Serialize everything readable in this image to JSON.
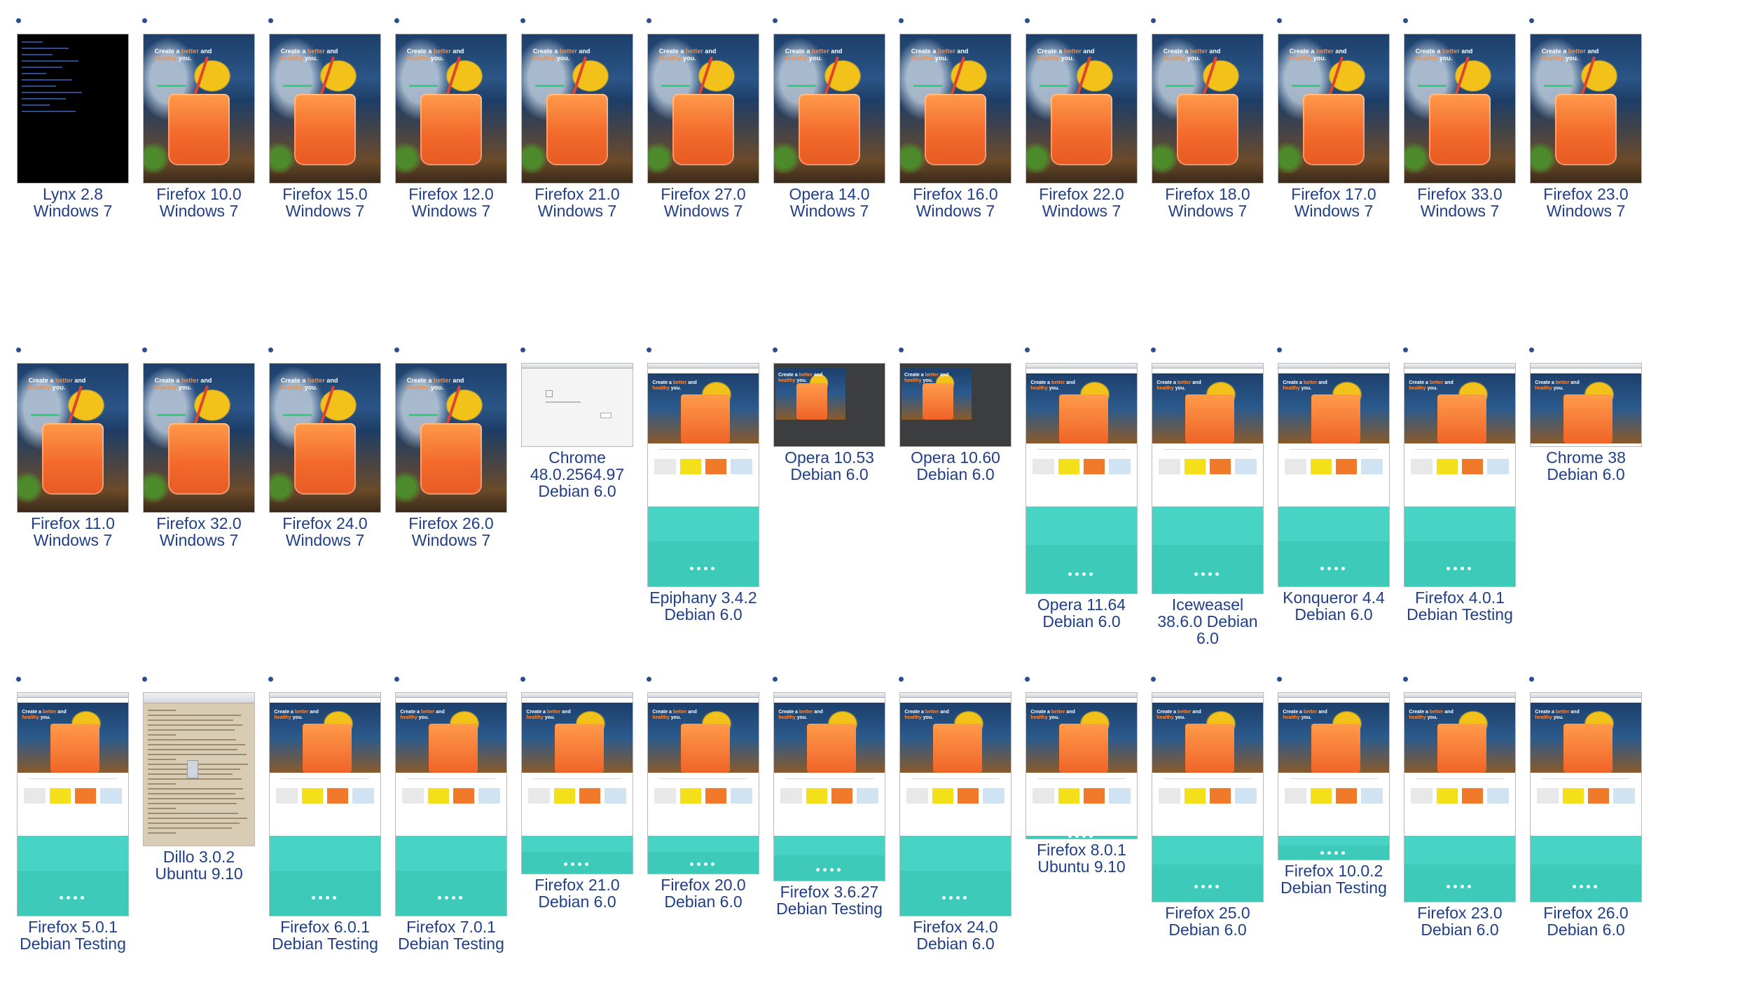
{
  "hero_text": {
    "line1": "Create a",
    "accent": "better",
    "line1b": "and",
    "line2": "healthy",
    "line2b": "you."
  },
  "rows": [
    [
      {
        "browser": "Lynx 2.8",
        "os": "Windows 7",
        "kind": "lynx"
      },
      {
        "browser": "Firefox 10.0",
        "os": "Windows 7",
        "kind": "tall"
      },
      {
        "browser": "Firefox 15.0",
        "os": "Windows 7",
        "kind": "tall"
      },
      {
        "browser": "Firefox 12.0",
        "os": "Windows 7",
        "kind": "tall"
      },
      {
        "browser": "Firefox 21.0",
        "os": "Windows 7",
        "kind": "tall"
      },
      {
        "browser": "Firefox 27.0",
        "os": "Windows 7",
        "kind": "tall"
      },
      {
        "browser": "Opera 14.0",
        "os": "Windows 7",
        "kind": "tall"
      },
      {
        "browser": "Firefox 16.0",
        "os": "Windows 7",
        "kind": "tall"
      },
      {
        "browser": "Firefox 22.0",
        "os": "Windows 7",
        "kind": "tall"
      },
      {
        "browser": "Firefox 18.0",
        "os": "Windows 7",
        "kind": "tall"
      },
      {
        "browser": "Firefox 17.0",
        "os": "Windows 7",
        "kind": "tall"
      },
      {
        "browser": "Firefox 33.0",
        "os": "Windows 7",
        "kind": "tall"
      },
      {
        "browser": "Firefox 23.0",
        "os": "Windows 7",
        "kind": "tall"
      }
    ],
    [
      {
        "browser": "Firefox 11.0",
        "os": "Windows 7",
        "kind": "tall"
      },
      {
        "browser": "Firefox 32.0",
        "os": "Windows 7",
        "kind": "tall"
      },
      {
        "browser": "Firefox 24.0",
        "os": "Windows 7",
        "kind": "tall"
      },
      {
        "browser": "Firefox 26.0",
        "os": "Windows 7",
        "kind": "tall"
      },
      {
        "browser": "Chrome 48.0.2564.97",
        "os": "Debian 6.0",
        "kind": "chrome"
      },
      {
        "browser": "Epiphany 3.4.2",
        "os": "Debian 6.0",
        "kind": "page"
      },
      {
        "browser": "Opera 10.53",
        "os": "Debian 6.0",
        "kind": "dark"
      },
      {
        "browser": "Opera 10.60",
        "os": "Debian 6.0",
        "kind": "dark"
      },
      {
        "browser": "Opera 11.64",
        "os": "Debian 6.0",
        "kind": "page"
      },
      {
        "browser": "Iceweasel 38.6.0 Debian 6.0",
        "os": "",
        "kind": "page"
      },
      {
        "browser": "Konqueror 4.4",
        "os": "Debian 6.0",
        "kind": "page"
      },
      {
        "browser": "Firefox 4.0.1",
        "os": "Debian Testing",
        "kind": "page"
      },
      {
        "browser": "Chrome 38",
        "os": "Debian 6.0",
        "kind": "short"
      }
    ],
    [
      {
        "browser": "Firefox 5.0.1",
        "os": "Debian Testing",
        "kind": "page"
      },
      {
        "browser": "Dillo 3.0.2",
        "os": "Ubuntu 9.10",
        "kind": "dillo"
      },
      {
        "browser": "Firefox 6.0.1",
        "os": "Debian Testing",
        "kind": "page"
      },
      {
        "browser": "Firefox 7.0.1",
        "os": "Debian Testing",
        "kind": "page"
      },
      {
        "browser": "Firefox 21.0",
        "os": "Debian 6.0",
        "kind": "page"
      },
      {
        "browser": "Firefox 20.0",
        "os": "Debian 6.0",
        "kind": "page"
      },
      {
        "browser": "Firefox 3.6.27",
        "os": "Debian Testing",
        "kind": "page"
      },
      {
        "browser": "Firefox 24.0",
        "os": "Debian 6.0",
        "kind": "page"
      },
      {
        "browser": "Firefox 8.0.1",
        "os": "Ubuntu 9.10",
        "kind": "page"
      },
      {
        "browser": "Firefox 25.0",
        "os": "Debian 6.0",
        "kind": "page"
      },
      {
        "browser": "Firefox 10.0.2",
        "os": "Debian Testing",
        "kind": "page"
      },
      {
        "browser": "Firefox 23.0",
        "os": "Debian 6.0",
        "kind": "page"
      },
      {
        "browser": "Firefox 26.0",
        "os": "Debian 6.0",
        "kind": "page"
      }
    ]
  ]
}
